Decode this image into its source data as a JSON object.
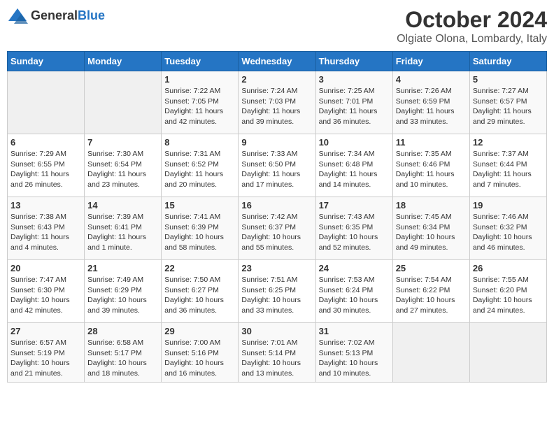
{
  "header": {
    "logo_general": "General",
    "logo_blue": "Blue",
    "month_title": "October 2024",
    "location": "Olgiate Olona, Lombardy, Italy"
  },
  "days_of_week": [
    "Sunday",
    "Monday",
    "Tuesday",
    "Wednesday",
    "Thursday",
    "Friday",
    "Saturday"
  ],
  "weeks": [
    [
      {
        "day": "",
        "sunrise": "",
        "sunset": "",
        "daylight": ""
      },
      {
        "day": "",
        "sunrise": "",
        "sunset": "",
        "daylight": ""
      },
      {
        "day": "1",
        "sunrise": "Sunrise: 7:22 AM",
        "sunset": "Sunset: 7:05 PM",
        "daylight": "Daylight: 11 hours and 42 minutes."
      },
      {
        "day": "2",
        "sunrise": "Sunrise: 7:24 AM",
        "sunset": "Sunset: 7:03 PM",
        "daylight": "Daylight: 11 hours and 39 minutes."
      },
      {
        "day": "3",
        "sunrise": "Sunrise: 7:25 AM",
        "sunset": "Sunset: 7:01 PM",
        "daylight": "Daylight: 11 hours and 36 minutes."
      },
      {
        "day": "4",
        "sunrise": "Sunrise: 7:26 AM",
        "sunset": "Sunset: 6:59 PM",
        "daylight": "Daylight: 11 hours and 33 minutes."
      },
      {
        "day": "5",
        "sunrise": "Sunrise: 7:27 AM",
        "sunset": "Sunset: 6:57 PM",
        "daylight": "Daylight: 11 hours and 29 minutes."
      }
    ],
    [
      {
        "day": "6",
        "sunrise": "Sunrise: 7:29 AM",
        "sunset": "Sunset: 6:55 PM",
        "daylight": "Daylight: 11 hours and 26 minutes."
      },
      {
        "day": "7",
        "sunrise": "Sunrise: 7:30 AM",
        "sunset": "Sunset: 6:54 PM",
        "daylight": "Daylight: 11 hours and 23 minutes."
      },
      {
        "day": "8",
        "sunrise": "Sunrise: 7:31 AM",
        "sunset": "Sunset: 6:52 PM",
        "daylight": "Daylight: 11 hours and 20 minutes."
      },
      {
        "day": "9",
        "sunrise": "Sunrise: 7:33 AM",
        "sunset": "Sunset: 6:50 PM",
        "daylight": "Daylight: 11 hours and 17 minutes."
      },
      {
        "day": "10",
        "sunrise": "Sunrise: 7:34 AM",
        "sunset": "Sunset: 6:48 PM",
        "daylight": "Daylight: 11 hours and 14 minutes."
      },
      {
        "day": "11",
        "sunrise": "Sunrise: 7:35 AM",
        "sunset": "Sunset: 6:46 PM",
        "daylight": "Daylight: 11 hours and 10 minutes."
      },
      {
        "day": "12",
        "sunrise": "Sunrise: 7:37 AM",
        "sunset": "Sunset: 6:44 PM",
        "daylight": "Daylight: 11 hours and 7 minutes."
      }
    ],
    [
      {
        "day": "13",
        "sunrise": "Sunrise: 7:38 AM",
        "sunset": "Sunset: 6:43 PM",
        "daylight": "Daylight: 11 hours and 4 minutes."
      },
      {
        "day": "14",
        "sunrise": "Sunrise: 7:39 AM",
        "sunset": "Sunset: 6:41 PM",
        "daylight": "Daylight: 11 hours and 1 minute."
      },
      {
        "day": "15",
        "sunrise": "Sunrise: 7:41 AM",
        "sunset": "Sunset: 6:39 PM",
        "daylight": "Daylight: 10 hours and 58 minutes."
      },
      {
        "day": "16",
        "sunrise": "Sunrise: 7:42 AM",
        "sunset": "Sunset: 6:37 PM",
        "daylight": "Daylight: 10 hours and 55 minutes."
      },
      {
        "day": "17",
        "sunrise": "Sunrise: 7:43 AM",
        "sunset": "Sunset: 6:35 PM",
        "daylight": "Daylight: 10 hours and 52 minutes."
      },
      {
        "day": "18",
        "sunrise": "Sunrise: 7:45 AM",
        "sunset": "Sunset: 6:34 PM",
        "daylight": "Daylight: 10 hours and 49 minutes."
      },
      {
        "day": "19",
        "sunrise": "Sunrise: 7:46 AM",
        "sunset": "Sunset: 6:32 PM",
        "daylight": "Daylight: 10 hours and 46 minutes."
      }
    ],
    [
      {
        "day": "20",
        "sunrise": "Sunrise: 7:47 AM",
        "sunset": "Sunset: 6:30 PM",
        "daylight": "Daylight: 10 hours and 42 minutes."
      },
      {
        "day": "21",
        "sunrise": "Sunrise: 7:49 AM",
        "sunset": "Sunset: 6:29 PM",
        "daylight": "Daylight: 10 hours and 39 minutes."
      },
      {
        "day": "22",
        "sunrise": "Sunrise: 7:50 AM",
        "sunset": "Sunset: 6:27 PM",
        "daylight": "Daylight: 10 hours and 36 minutes."
      },
      {
        "day": "23",
        "sunrise": "Sunrise: 7:51 AM",
        "sunset": "Sunset: 6:25 PM",
        "daylight": "Daylight: 10 hours and 33 minutes."
      },
      {
        "day": "24",
        "sunrise": "Sunrise: 7:53 AM",
        "sunset": "Sunset: 6:24 PM",
        "daylight": "Daylight: 10 hours and 30 minutes."
      },
      {
        "day": "25",
        "sunrise": "Sunrise: 7:54 AM",
        "sunset": "Sunset: 6:22 PM",
        "daylight": "Daylight: 10 hours and 27 minutes."
      },
      {
        "day": "26",
        "sunrise": "Sunrise: 7:55 AM",
        "sunset": "Sunset: 6:20 PM",
        "daylight": "Daylight: 10 hours and 24 minutes."
      }
    ],
    [
      {
        "day": "27",
        "sunrise": "Sunrise: 6:57 AM",
        "sunset": "Sunset: 5:19 PM",
        "daylight": "Daylight: 10 hours and 21 minutes."
      },
      {
        "day": "28",
        "sunrise": "Sunrise: 6:58 AM",
        "sunset": "Sunset: 5:17 PM",
        "daylight": "Daylight: 10 hours and 18 minutes."
      },
      {
        "day": "29",
        "sunrise": "Sunrise: 7:00 AM",
        "sunset": "Sunset: 5:16 PM",
        "daylight": "Daylight: 10 hours and 16 minutes."
      },
      {
        "day": "30",
        "sunrise": "Sunrise: 7:01 AM",
        "sunset": "Sunset: 5:14 PM",
        "daylight": "Daylight: 10 hours and 13 minutes."
      },
      {
        "day": "31",
        "sunrise": "Sunrise: 7:02 AM",
        "sunset": "Sunset: 5:13 PM",
        "daylight": "Daylight: 10 hours and 10 minutes."
      },
      {
        "day": "",
        "sunrise": "",
        "sunset": "",
        "daylight": ""
      },
      {
        "day": "",
        "sunrise": "",
        "sunset": "",
        "daylight": ""
      }
    ]
  ]
}
